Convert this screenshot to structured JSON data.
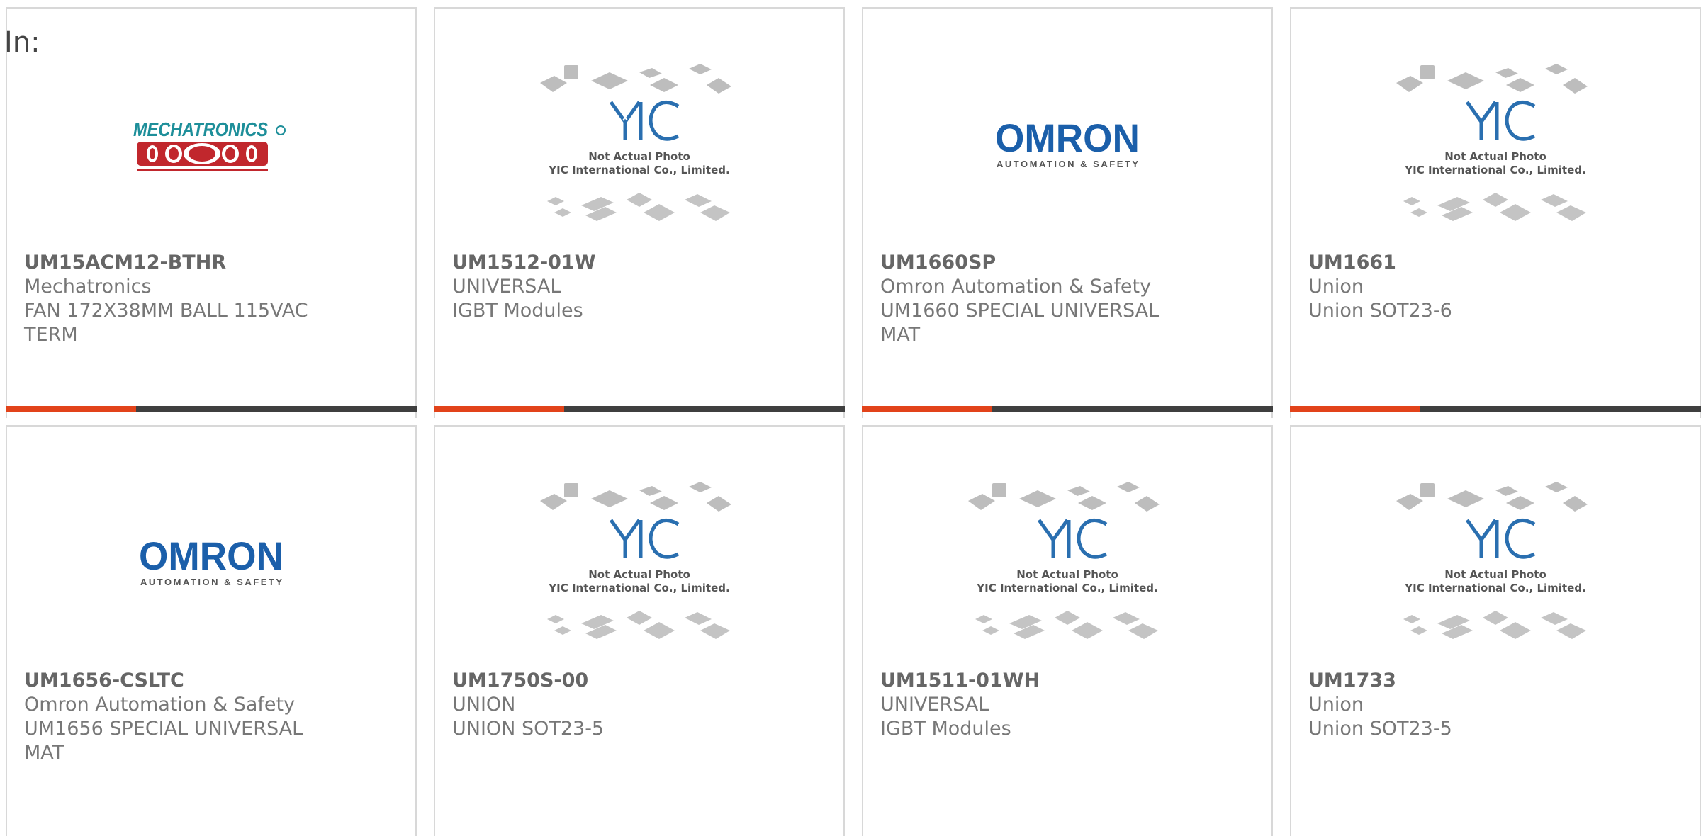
{
  "filter_label": "In:",
  "accent_color": "#e2431a",
  "bar_color": "#3f3f3f",
  "placeholder_caption": {
    "line1": "Not Actual Photo",
    "line2": "YIC International Co., Limited."
  },
  "logos": {
    "mechatronics": "MECHATRONICS",
    "omron": "OMRON",
    "omron_tag": "AUTOMATION & SAFETY"
  },
  "products": [
    {
      "part": "UM15ACM12-BTHR",
      "maker": "Mechatronics",
      "desc": "FAN 172X38MM BALL 115VAC TERM",
      "image": "mechatronics-logo"
    },
    {
      "part": "UM1512-01W",
      "maker": "UNIVERSAL",
      "desc": "IGBT Modules",
      "image": "not-actual-photo"
    },
    {
      "part": "UM1660SP",
      "maker": "Omron Automation & Safety",
      "desc": "UM1660 SPECIAL UNIVERSAL MAT",
      "image": "omron-logo"
    },
    {
      "part": "UM1661",
      "maker": "Union",
      "desc": "Union SOT23-6",
      "image": "not-actual-photo"
    },
    {
      "part": "UM1656-CSLTC",
      "maker": "Omron Automation & Safety",
      "desc": "UM1656 SPECIAL UNIVERSAL MAT",
      "image": "omron-logo"
    },
    {
      "part": "UM1750S-00",
      "maker": "UNION",
      "desc": "UNION SOT23-5",
      "image": "not-actual-photo"
    },
    {
      "part": "UM1511-01WH",
      "maker": "UNIVERSAL",
      "desc": "IGBT Modules",
      "image": "not-actual-photo"
    },
    {
      "part": "UM1733",
      "maker": "Union",
      "desc": "Union SOT23-5",
      "image": "not-actual-photo"
    }
  ]
}
